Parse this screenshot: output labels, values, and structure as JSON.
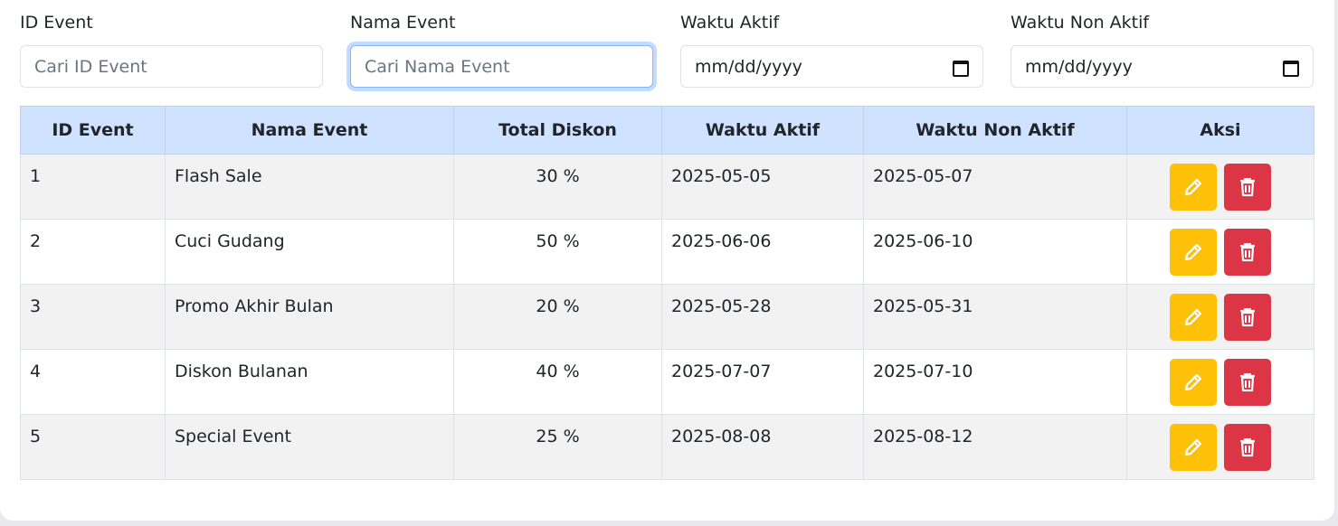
{
  "filters": {
    "id_event": {
      "label": "ID Event",
      "placeholder": "Cari ID Event"
    },
    "nama_event": {
      "label": "Nama Event",
      "placeholder": "Cari Nama Event"
    },
    "waktu_aktif": {
      "label": "Waktu Aktif",
      "placeholder": "mm/dd/yyyy"
    },
    "waktu_non_aktif": {
      "label": "Waktu Non Aktif",
      "placeholder": "mm/dd/yyyy"
    }
  },
  "table": {
    "headers": [
      "ID Event",
      "Nama Event",
      "Total Diskon",
      "Waktu Aktif",
      "Waktu Non Aktif",
      "Aksi"
    ],
    "rows": [
      {
        "id": "1",
        "nama": "Flash Sale",
        "diskon": "30 %",
        "aktif": "2025-05-05",
        "non_aktif": "2025-05-07"
      },
      {
        "id": "2",
        "nama": "Cuci Gudang",
        "diskon": "50 %",
        "aktif": "2025-06-06",
        "non_aktif": "2025-06-10"
      },
      {
        "id": "3",
        "nama": "Promo Akhir Bulan",
        "diskon": "20 %",
        "aktif": "2025-05-28",
        "non_aktif": "2025-05-31"
      },
      {
        "id": "4",
        "nama": "Diskon Bulanan",
        "diskon": "40 %",
        "aktif": "2025-07-07",
        "non_aktif": "2025-07-10"
      },
      {
        "id": "5",
        "nama": "Special Event",
        "diskon": "25 %",
        "aktif": "2025-08-08",
        "non_aktif": "2025-08-12"
      }
    ]
  },
  "icons": {
    "edit": "pencil-icon",
    "delete": "trash-icon",
    "date": "calendar-icon"
  },
  "colors": {
    "header_bg": "#cfe2ff",
    "edit": "#ffc107",
    "delete": "#dc3545",
    "focus": "#86b7fe"
  }
}
